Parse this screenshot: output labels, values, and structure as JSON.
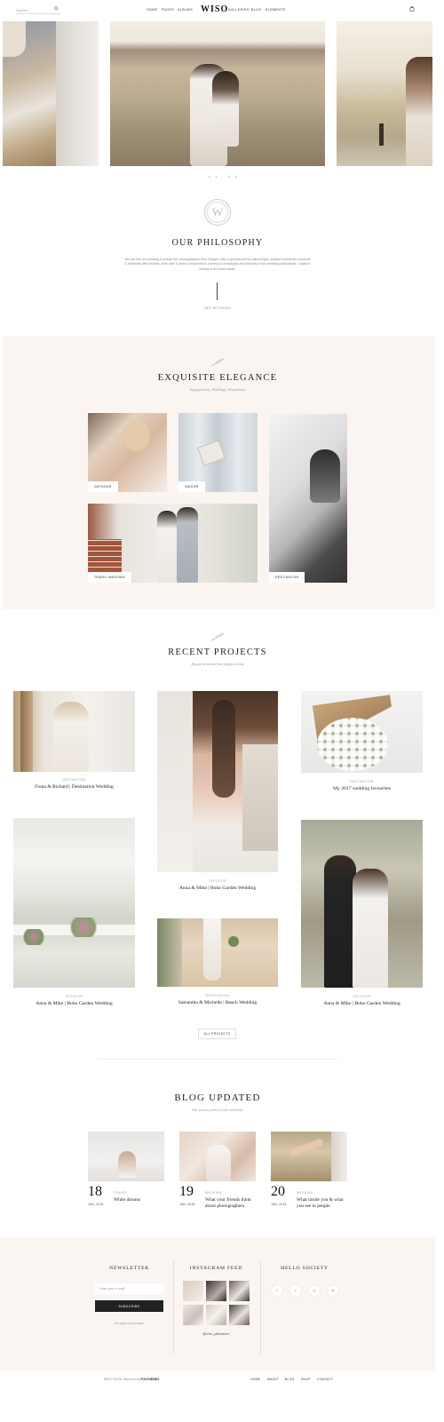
{
  "header": {
    "search_placeholder": "Search...",
    "nav_left": [
      "HOME",
      "PAGES",
      "ALBUMS"
    ],
    "logo": "WISO",
    "nav_right": [
      "GALLERIES",
      "BLOG",
      "ELEMENTS"
    ]
  },
  "carousel": {
    "pager": "01  02"
  },
  "philosophy": {
    "emblem": "W",
    "title": "OUR PHILOSOPHY",
    "text": "We are fine art wedding & portrait film photographers from Oregon, with a special love for natural light, medium format film cameras & redheads with freckles. With over 5 years of experience, numerous workshops and features in top wedding publications, I capture beauty in the most subtle.",
    "link": "GET IN TOUCH"
  },
  "elegance": {
    "title": "EXQUISITE ELEGANCE",
    "subtitle": "Engagements, Weddings, Elopements",
    "tiles": [
      {
        "tag": "OUTDOOR"
      },
      {
        "tag": "INDOOR"
      },
      {
        "tag": "TRAVEL WEDDING"
      },
      {
        "tag": "DESTINATION"
      }
    ]
  },
  "projects": {
    "title": "RECENT PROJECTS",
    "subtitle": "Happy moments from happy clients",
    "items": [
      {
        "cat": "DESTINATION",
        "title": "Fiona & Richard | Destination Wedding"
      },
      {
        "cat": "OUTDOOR",
        "title": "Anna & Mike | Boho Garden Wedding"
      },
      {
        "cat": "DESTINATION",
        "title": "My 2017 wedding favourites"
      },
      {
        "cat": "OUTDOOR",
        "title": "Anna & Mike | Boho Garden Wedding"
      },
      {
        "cat": "DESTINATION",
        "title": "Samantha & Michelle | Beach Wedding"
      },
      {
        "cat": "OUTDOOR",
        "title": "Anna & Mike | Boho Garden Wedding"
      }
    ],
    "all_button": "ALL PROJECTS"
  },
  "blog": {
    "title": "BLOG UPDATED",
    "subtitle": "Our secrets from friends and bride",
    "posts": [
      {
        "day": "18",
        "month": "JAN, 2018",
        "cat": "TRAVEL",
        "title": "White dreams"
      },
      {
        "day": "19",
        "month": "JAN, 2018",
        "cat": "WEDDING",
        "title": "What your friends think about photographers"
      },
      {
        "day": "20",
        "month": "JAN, 2018",
        "cat": "WEDDING",
        "title": "What inside you & what you see in people."
      }
    ]
  },
  "footer": {
    "newsletter_title": "NEWSLETTER",
    "email_placeholder": "Enter your e-mail*",
    "subscribe_label": "SUBSCRIBE",
    "nospam": "No spam, we promise",
    "instagram_title": "INSTAGRAM FEED",
    "instagram_handle": "@wiso_photostore",
    "social_title": "HELLO SOCIETY",
    "social_icons": [
      "f",
      "t",
      "◎",
      "in"
    ],
    "copyright_prefix": "WISO ©2018. With love by",
    "copyright_brand": "FOXTHEMES",
    "nav": [
      "HOME",
      "ABOUT",
      "BLOG",
      "SHOP",
      "CONTACT"
    ]
  }
}
